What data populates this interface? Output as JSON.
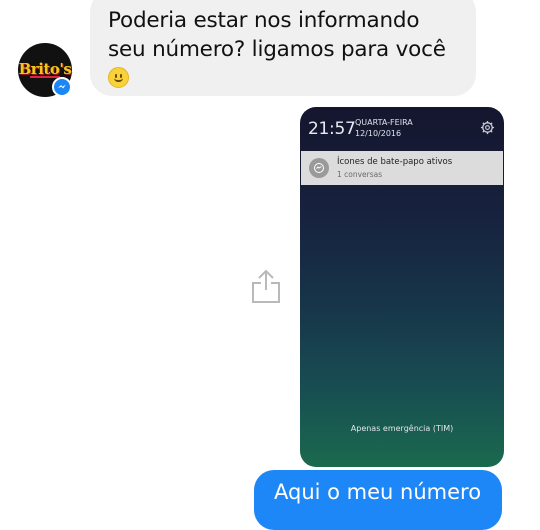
{
  "conversation": {
    "incoming_message": {
      "sender_avatar_text": "Brito's",
      "line1": "Poderia estar nos informando",
      "line2": "seu número? ligamos para você",
      "emoji": "slightly-smiling-face"
    },
    "outgoing_screenshot": {
      "time": "21:57",
      "weekday": "QUARTA-FEIRA",
      "date": "12/10/2016",
      "notification_title": "Ícones de bate-papo ativos",
      "notification_subtitle": "1 conversas",
      "emergency_text": "Apenas emergência (TIM)"
    },
    "outgoing_message_partial": "Aqui o meu número"
  },
  "icons": {
    "share": "share-icon",
    "messenger_badge": "messenger-badge-icon",
    "settings": "gear-icon",
    "chat_heads": "chat-bubble-icon"
  },
  "colors": {
    "incoming_bubble": "#f1f0f0",
    "outgoing_bubble": "#1e87f7",
    "messenger_blue": "#1b86f5",
    "logo_yellow": "#f5c61a"
  }
}
